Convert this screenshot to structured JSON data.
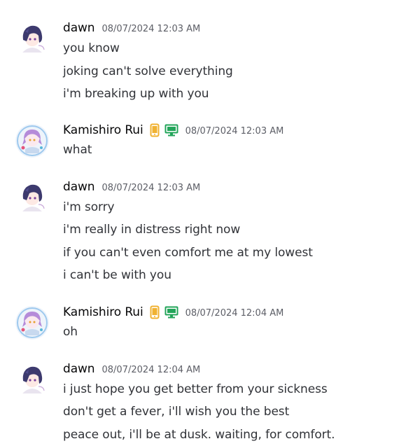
{
  "messages": [
    {
      "author": "dawn",
      "timestamp": "08/07/2024 12:03 AM",
      "avatar_icon": "dawn-avatar",
      "badges": [],
      "lines": [
        "you know",
        "joking can't solve everything",
        "i'm breaking up with you"
      ]
    },
    {
      "author": "Kamishiro Rui",
      "timestamp": "08/07/2024 12:03 AM",
      "avatar_icon": "rui-avatar",
      "badges": [
        "mobile-icon",
        "desktop-icon"
      ],
      "lines": [
        "what"
      ]
    },
    {
      "author": "dawn",
      "timestamp": "08/07/2024 12:03 AM",
      "avatar_icon": "dawn-avatar",
      "badges": [],
      "lines": [
        "i'm sorry",
        "i'm really in distress right now",
        "if you can't even comfort me at my lowest",
        "i can't be with you"
      ]
    },
    {
      "author": "Kamishiro Rui",
      "timestamp": "08/07/2024 12:04 AM",
      "avatar_icon": "rui-avatar",
      "badges": [
        "mobile-icon",
        "desktop-icon"
      ],
      "lines": [
        "oh"
      ]
    },
    {
      "author": "dawn",
      "timestamp": "08/07/2024 12:04 AM",
      "avatar_icon": "dawn-avatar",
      "badges": [],
      "lines": [
        "i just hope you get better from your sickness",
        "don't get a fever, i'll wish you the best",
        "peace out, i'll be at dusk. waiting, for comfort."
      ]
    }
  ],
  "colors": {
    "mobile_badge": "#f0b232",
    "desktop_badge": "#23a55a"
  }
}
